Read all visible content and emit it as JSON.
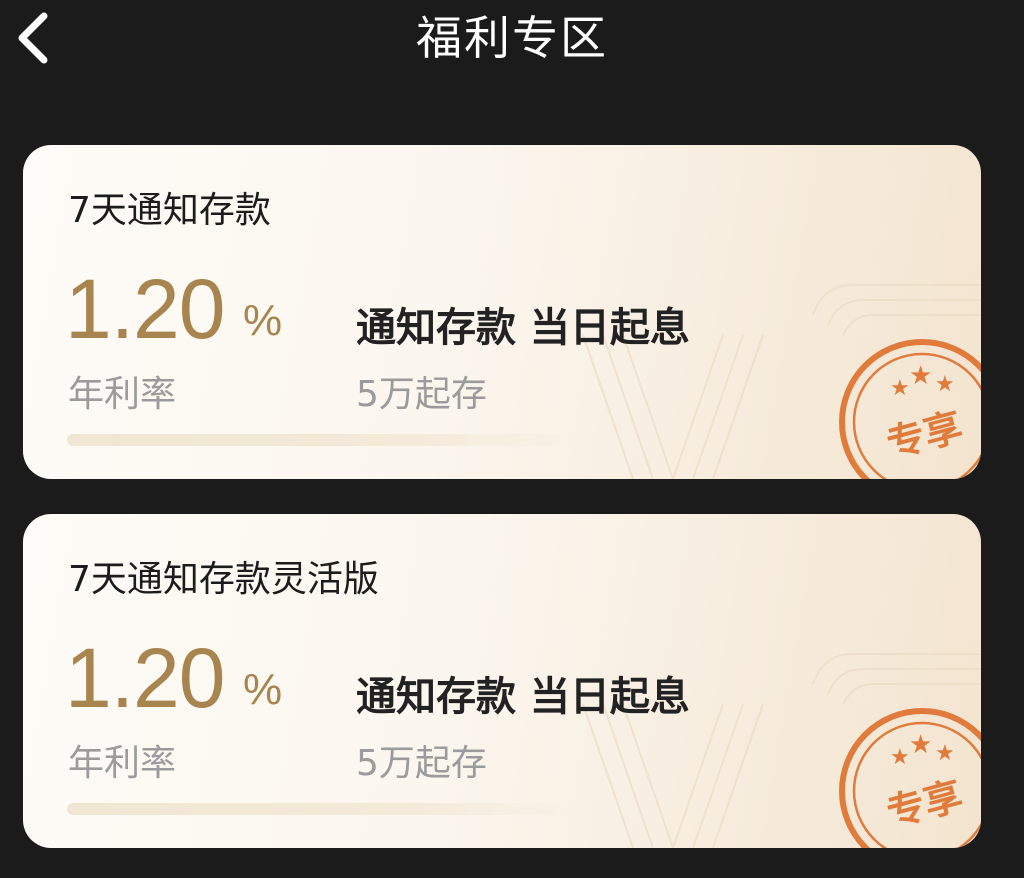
{
  "header": {
    "title": "福利专区"
  },
  "cards": [
    {
      "title": "7天通知存款",
      "rate": "1.20",
      "rate_unit": "%",
      "rate_label": "年利率",
      "feature": "通知存款 当日起息",
      "min_deposit": "5万起存",
      "badge": "专享"
    },
    {
      "title": "7天通知存款灵活版",
      "rate": "1.20",
      "rate_unit": "%",
      "rate_label": "年利率",
      "feature": "通知存款 当日起息",
      "min_deposit": "5万起存",
      "badge": "专享"
    }
  ],
  "colors": {
    "background": "#1b1b1b",
    "rate_gold": "#a8844f",
    "badge_orange": "#e07b3c"
  }
}
